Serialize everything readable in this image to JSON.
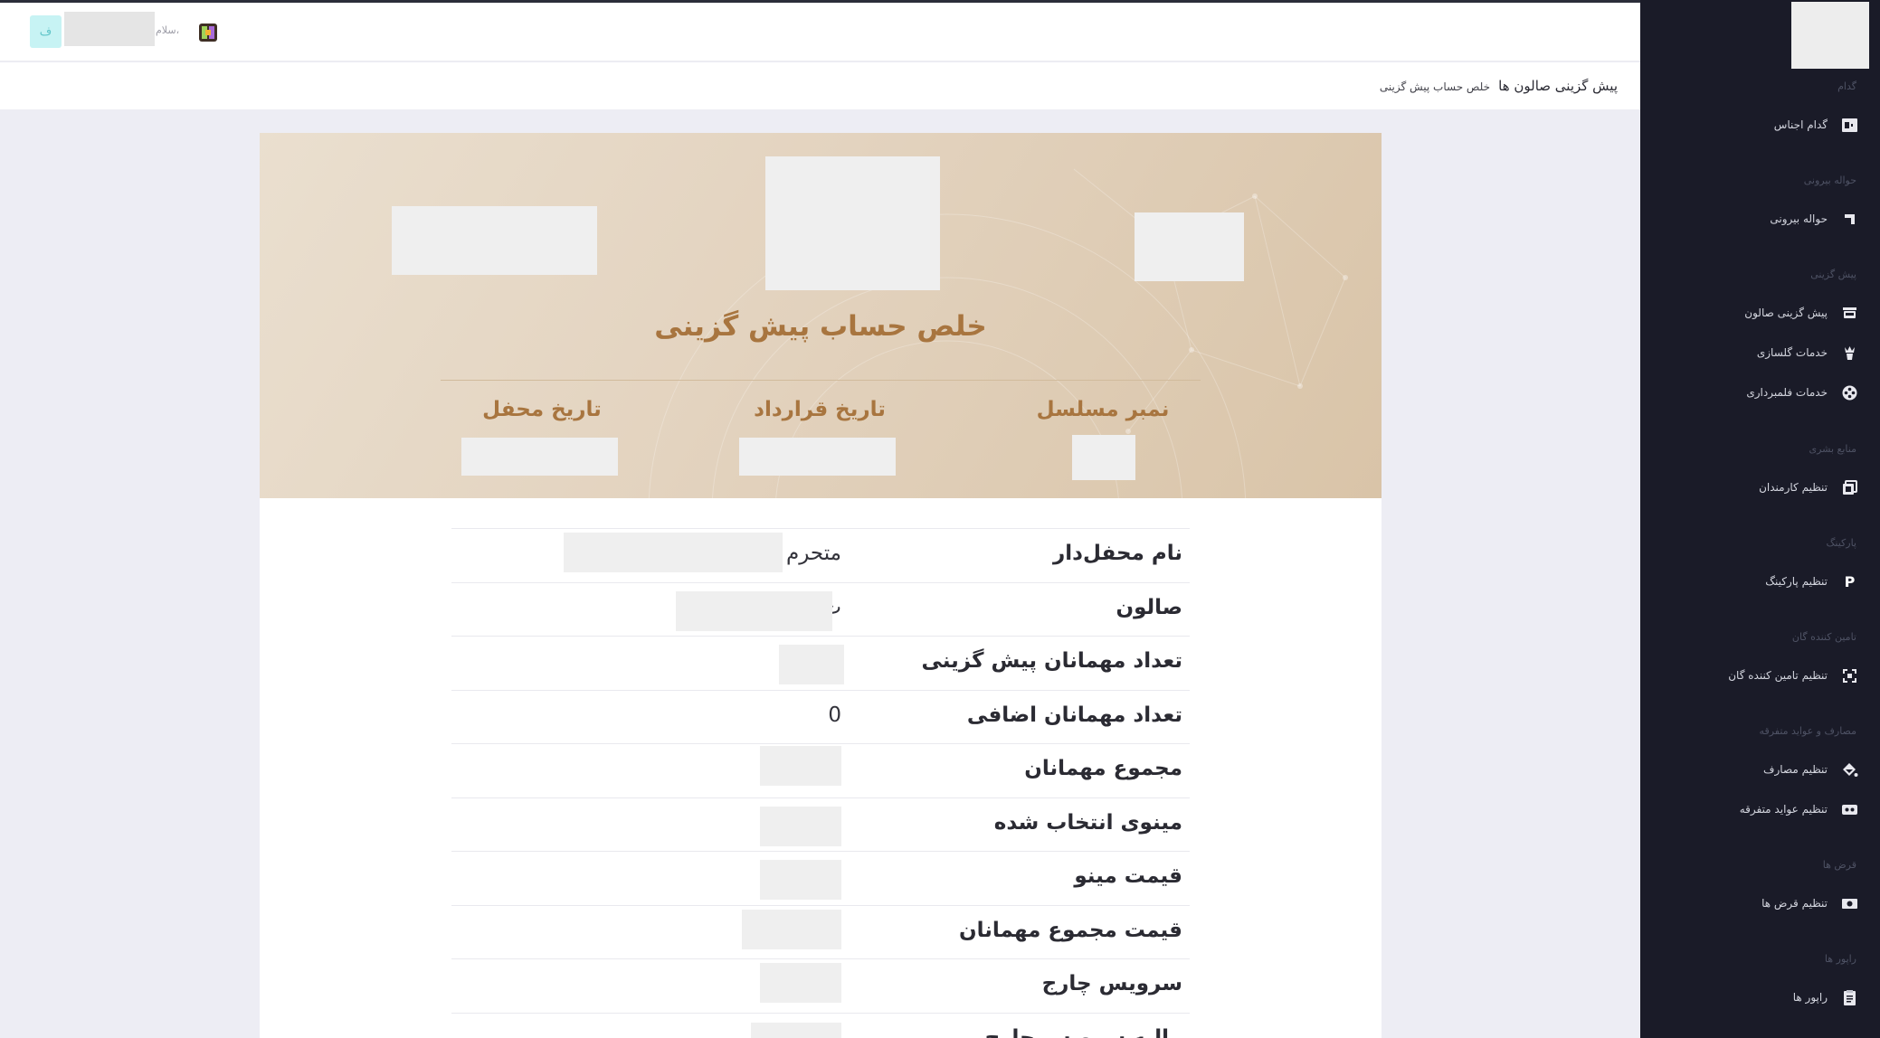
{
  "header": {
    "avatar_initial": "ف",
    "greeting": "سلام،"
  },
  "breadcrumb": {
    "current": "پیش گزینی صالون ها",
    "sub": "خلص حساب پیش گزینی"
  },
  "sidebar": {
    "sections": [
      {
        "title": "گدام",
        "items": [
          {
            "label": "گدام اجناس",
            "icon": "warehouse-icon"
          }
        ]
      },
      {
        "title": "حواله بیرونی",
        "items": [
          {
            "label": "حواله بیرونی",
            "icon": "transfer-icon"
          }
        ]
      },
      {
        "title": "پیش گزینی",
        "items": [
          {
            "label": "پیش گزینی صالون",
            "icon": "hall-icon"
          },
          {
            "label": "خدمات گلسازی",
            "icon": "flower-icon"
          },
          {
            "label": "خدمات فلمبرداری",
            "icon": "film-icon"
          }
        ]
      },
      {
        "title": "منابع بشری",
        "items": [
          {
            "label": "تنظیم کارمندان",
            "icon": "staff-icon"
          }
        ]
      },
      {
        "title": "پارکینگ",
        "items": [
          {
            "label": "تنظیم پارکینگ",
            "icon": "parking-icon"
          }
        ]
      },
      {
        "title": "تامین کننده گان",
        "items": [
          {
            "label": "تنظیم تامین کننده گان",
            "icon": "supplier-icon"
          }
        ]
      },
      {
        "title": "مصارف و عواید متفرقه",
        "items": [
          {
            "label": "تنظیم مصارف",
            "icon": "expense-icon"
          },
          {
            "label": "تنظیم عواید متفرقه",
            "icon": "income-icon"
          }
        ]
      },
      {
        "title": "قرض ها",
        "items": [
          {
            "label": "تنظیم قرض ها",
            "icon": "loan-icon"
          }
        ]
      },
      {
        "title": "راپور ها",
        "items": [
          {
            "label": "راپور ها",
            "icon": "report-icon"
          }
        ]
      }
    ]
  },
  "invoice": {
    "title": "خلص حساب پیش گزینی",
    "meta": {
      "serial_label": "نمبر مسلسل",
      "contract_label": "تاریخ قرارداد",
      "venue_date_label": "تاریخ محفل"
    },
    "rows": [
      {
        "label": "نام محفل‌دار",
        "value": "متحرم"
      },
      {
        "label": "صالون",
        "value": "ت"
      },
      {
        "label": "تعداد مهمانان پیش گزینی",
        "value": ""
      },
      {
        "label": "تعداد مهمانان اضافی",
        "value": "0"
      },
      {
        "label": "مجموع مهمانان",
        "value": ""
      },
      {
        "label": "مینوی انتخاب شده",
        "value": ""
      },
      {
        "label": "قیمت مینو",
        "value": ""
      },
      {
        "label": "قیمت مجموع مهمانان",
        "value": ""
      },
      {
        "label": "سرویس چارج",
        "value": ""
      },
      {
        "label": "مالیه سرویس چارج",
        "value": ""
      }
    ]
  }
}
